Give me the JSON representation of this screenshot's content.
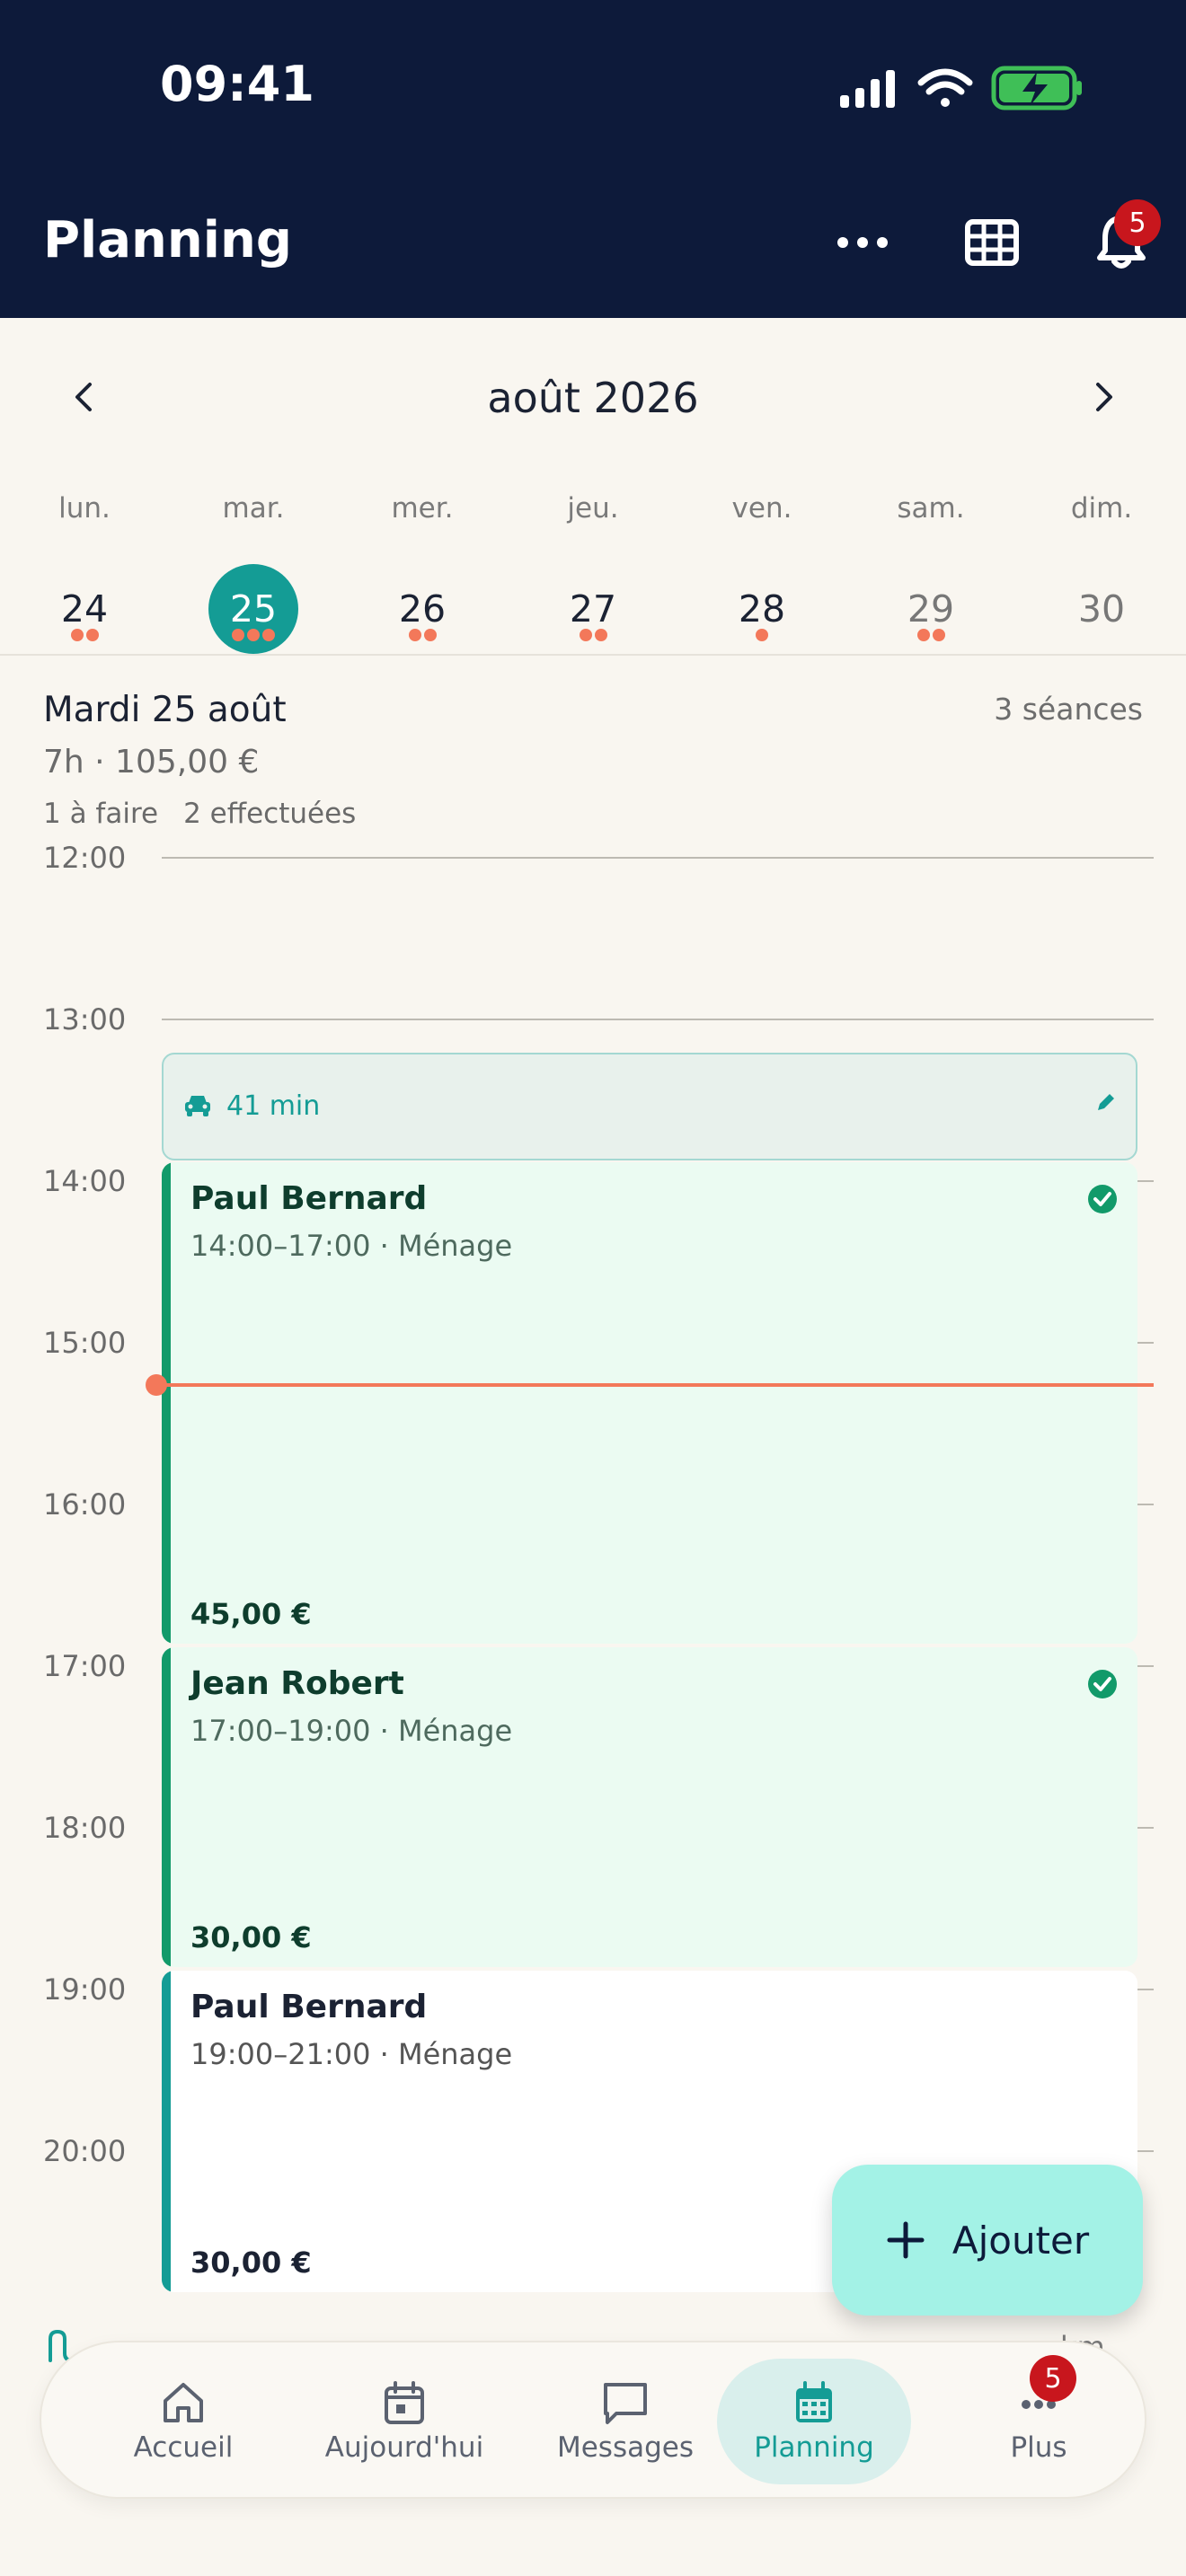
{
  "status_bar": {
    "time": "09:41"
  },
  "header": {
    "title": "Planning",
    "notifications_count": "5"
  },
  "calendar": {
    "month_label": "août 2026",
    "weekdays": [
      "lun.",
      "mar.",
      "mer.",
      "jeu.",
      "ven.",
      "sam.",
      "dim."
    ],
    "days": [
      {
        "num": "24",
        "dots": 2
      },
      {
        "num": "25",
        "dots": 3,
        "selected": true
      },
      {
        "num": "26",
        "dots": 2
      },
      {
        "num": "27",
        "dots": 2
      },
      {
        "num": "28",
        "dots": 1
      },
      {
        "num": "29",
        "dots": 2
      },
      {
        "num": "30",
        "dots": 0
      }
    ]
  },
  "day": {
    "title": "Mardi 25 août",
    "count": "3 séances",
    "summary": "7h · 105,00 €",
    "todo": "1 à faire",
    "done": "2 effectuées"
  },
  "hours": [
    "12:00",
    "13:00",
    "14:00",
    "15:00",
    "16:00",
    "17:00",
    "18:00",
    "19:00",
    "20:00"
  ],
  "travel": {
    "label": "41 min"
  },
  "events": [
    {
      "name": "Paul Bernard",
      "sub": "14:00–17:00 · Ménage",
      "price": "45,00 €"
    },
    {
      "name": "Jean Robert",
      "sub": "17:00–19:00 · Ménage",
      "price": "30,00 €"
    },
    {
      "name": "Paul Bernard",
      "sub": "19:00–21:00 · Ménage",
      "price": "30,00 €"
    }
  ],
  "fab": {
    "label": "Ajouter"
  },
  "under_tabbar_right": "km",
  "tabs": [
    {
      "label": "Accueil",
      "icon": "home-icon"
    },
    {
      "label": "Aujourd'hui",
      "icon": "calendar-day-icon"
    },
    {
      "label": "Messages",
      "icon": "chat-icon"
    },
    {
      "label": "Planning",
      "icon": "calendar-icon"
    },
    {
      "label": "Plus",
      "icon": "more-icon"
    }
  ],
  "plus_badge": "5",
  "colors": {
    "header_bg": "#0d1a3a",
    "accent": "#149c95",
    "done_accent": "#129a6a",
    "now_line": "#f3785a",
    "badge": "#c8161d"
  }
}
